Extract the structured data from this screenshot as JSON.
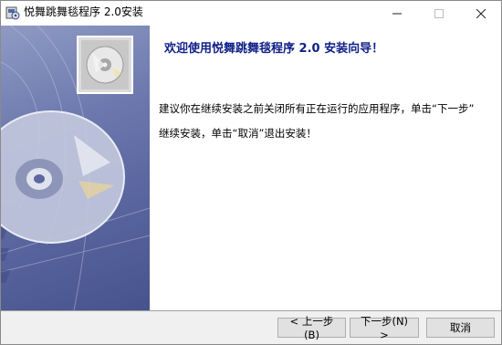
{
  "window": {
    "title": "悦舞跳舞毯程序 2.0安装",
    "controls": {
      "minimize_icon": "minimize-icon",
      "maximize_icon": "maximize-icon",
      "close_icon": "close-icon"
    }
  },
  "sidebar": {
    "image": "cd-disc-banner"
  },
  "content": {
    "heading": "欢迎使用悦舞跳舞毯程序 2.0 安装向导！",
    "message_line1": "建议你在继续安装之前关闭所有正在运行的应用程序，单击“下一步”",
    "message_line2": "继续安装，单击“取消”退出安装！"
  },
  "buttons": {
    "back": "< 上一步(B)",
    "next": "下一步(N) >",
    "cancel": "取消"
  }
}
